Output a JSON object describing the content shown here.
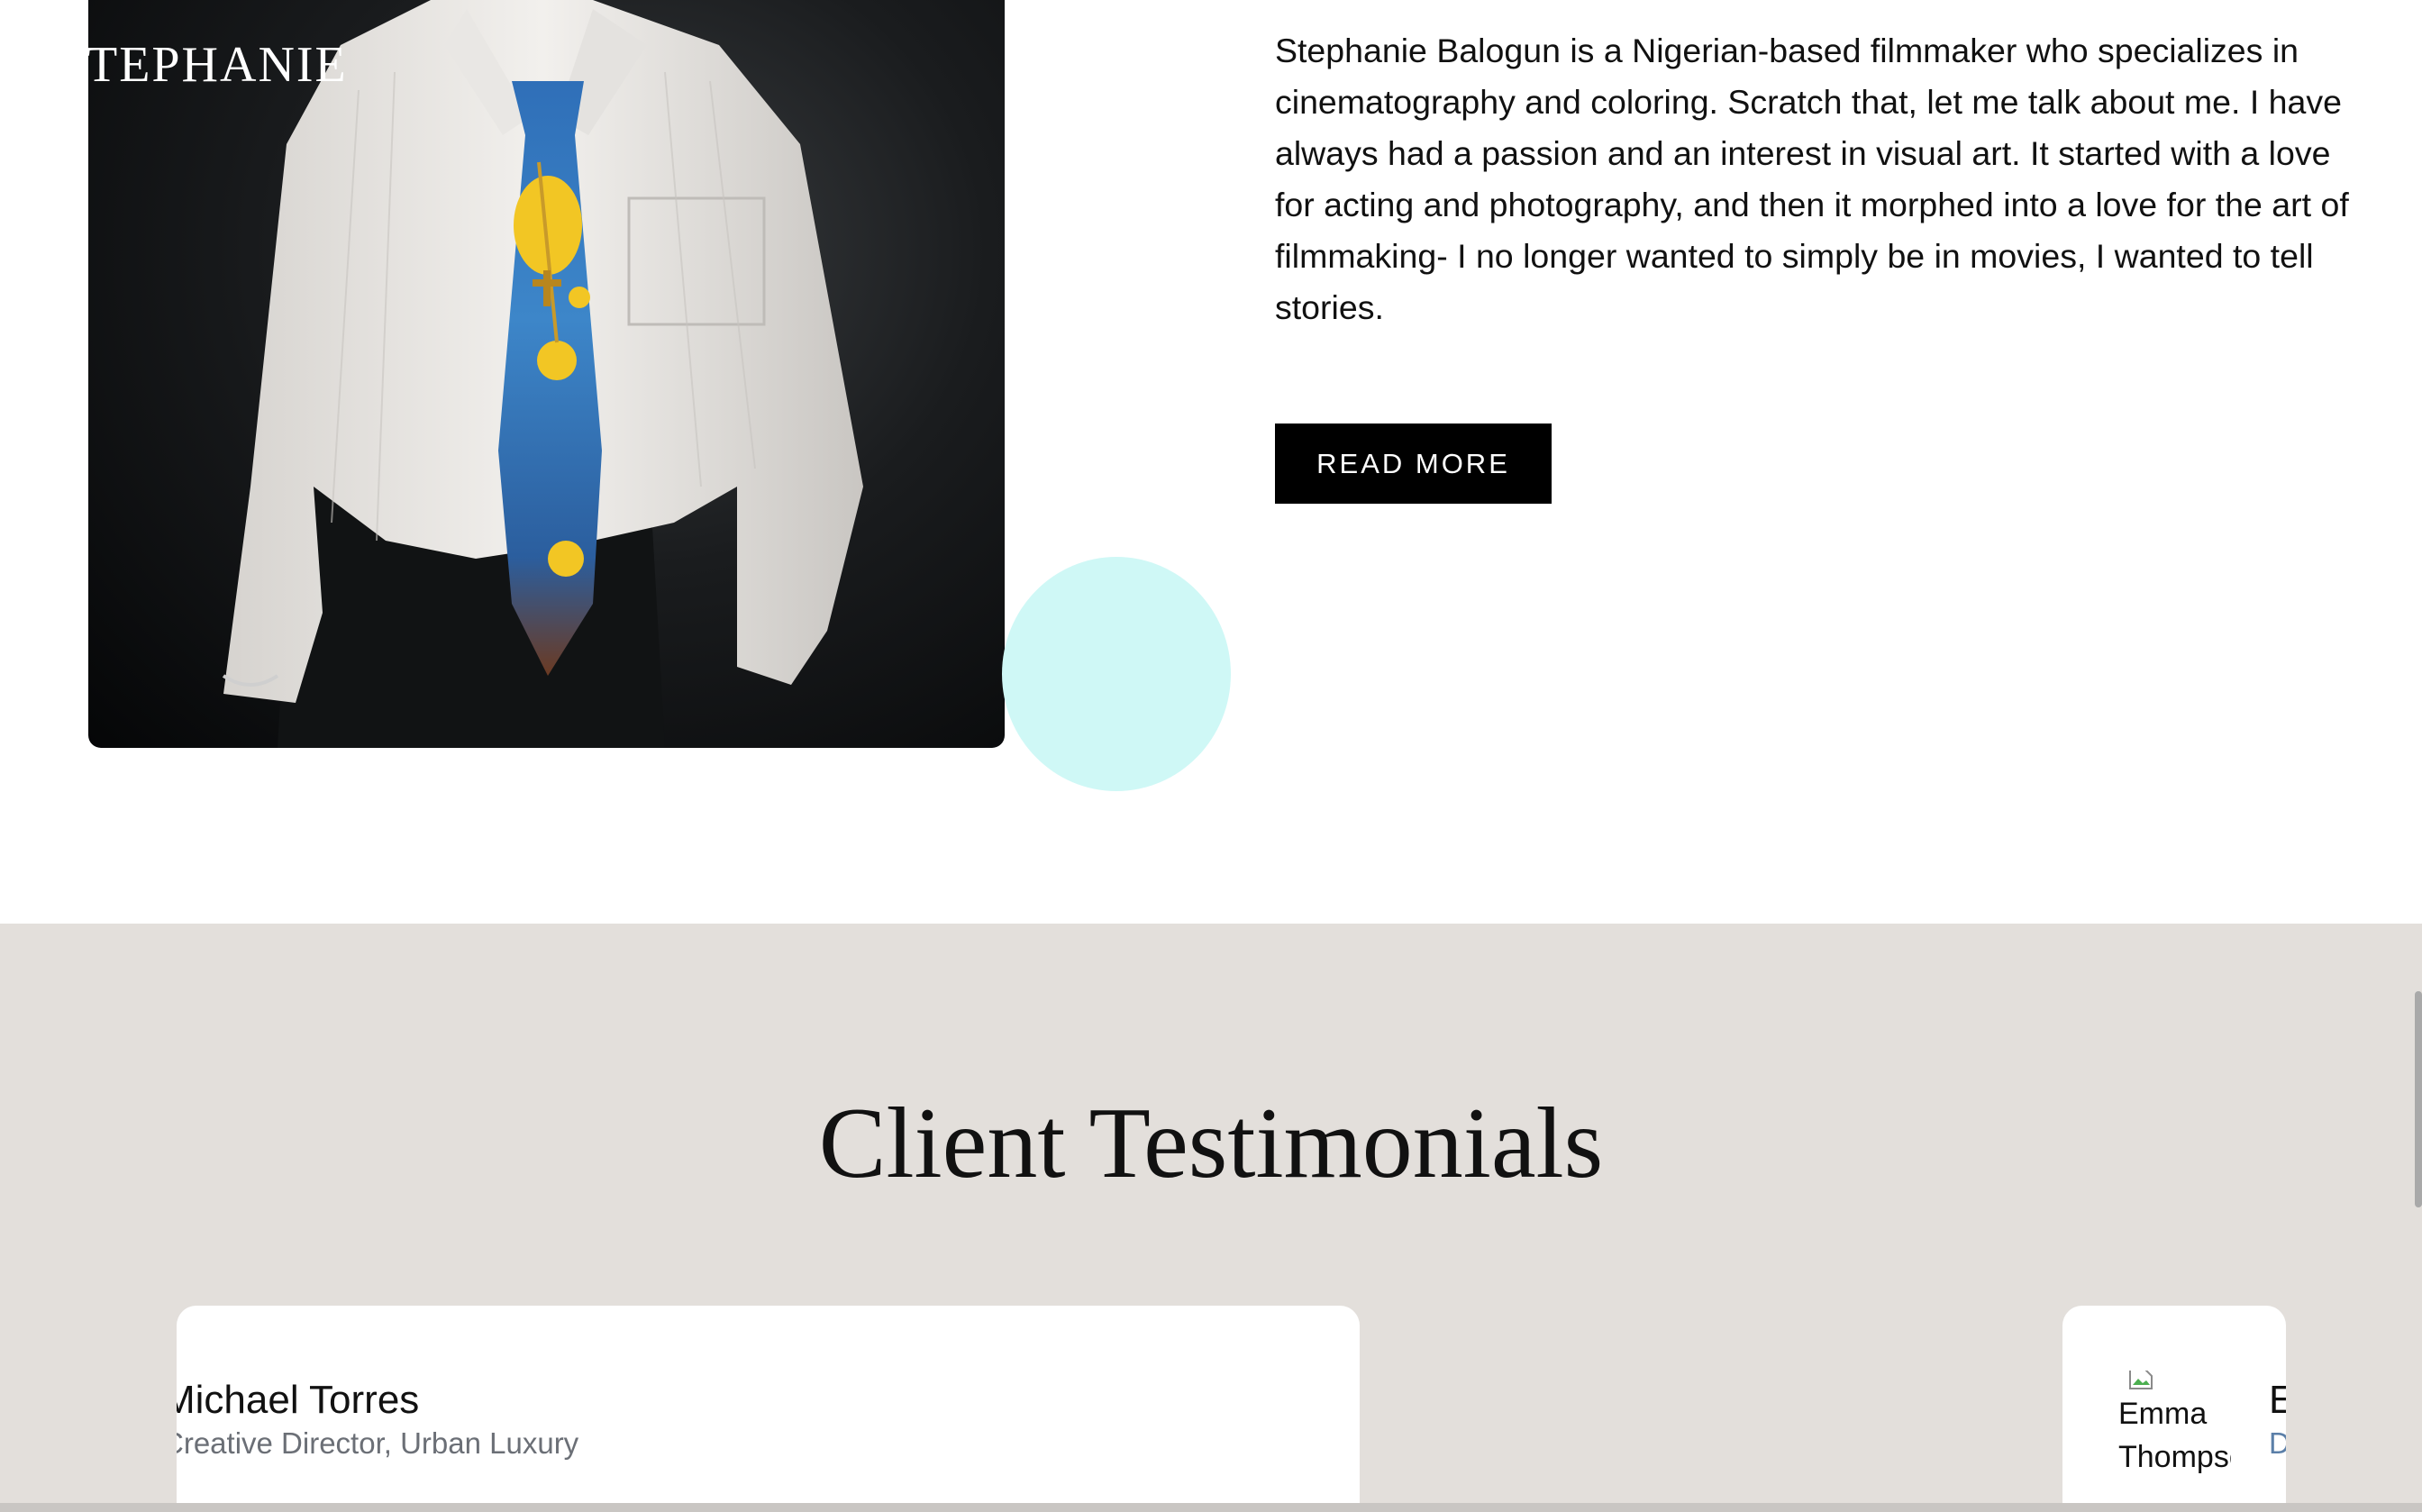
{
  "about": {
    "brand": "TEPHANIE",
    "bio": "Stephanie Balogun is a Nigerian-based filmmaker who specializes in cinematography and coloring. Scratch that, let me talk about me. I have always had a passion and an interest in visual art. It started with a love for acting and photography, and then it morphed into a love for the art of filmmaking- I no longer wanted to simply be in movies, I wanted to tell stories.",
    "read_more_label": "READ MORE",
    "accent_color": "#cff8f6"
  },
  "testimonials": {
    "title": "Client Testimonials",
    "cards": [
      {
        "name": "Michael Torres",
        "role": "Creative Director, Urban Luxury"
      },
      {
        "name": "E",
        "role": "D",
        "image_alt": "Emma Thompson"
      }
    ],
    "background": "#e3dfdb"
  }
}
